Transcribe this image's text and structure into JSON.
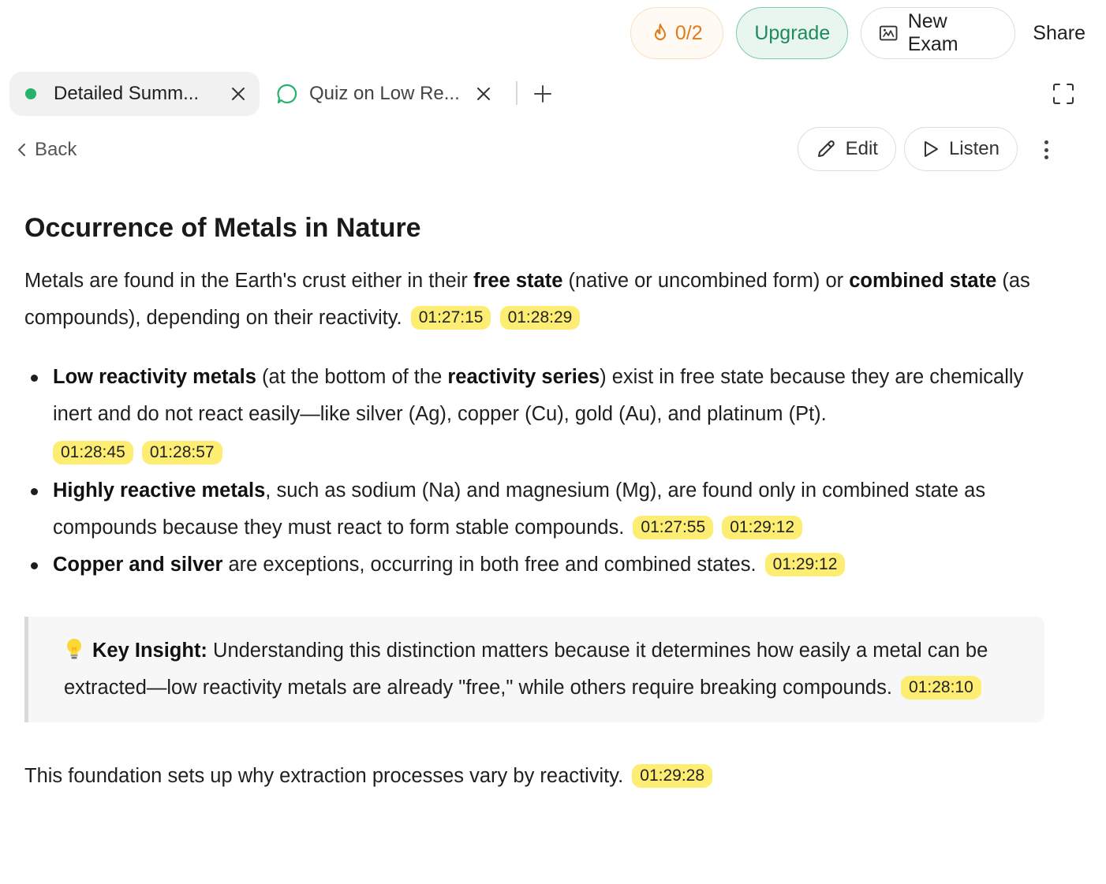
{
  "topbar": {
    "streak": "0/2",
    "upgrade": "Upgrade",
    "new_exam": "New Exam",
    "share": "Share"
  },
  "tabs": [
    {
      "label": "Detailed Summ..."
    },
    {
      "label": "Quiz on Low Re..."
    }
  ],
  "toolbar": {
    "back": "Back",
    "edit": "Edit",
    "listen": "Listen"
  },
  "article": {
    "title": "Occurrence of Metals in Nature",
    "intro": {
      "t1": "Metals are found in the Earth's crust either in their ",
      "b1": "free state",
      "t2": " (native or uncombined form) or ",
      "b2": "combined state",
      "t3": " (as compounds), depending on their reactivity.",
      "ts": [
        "01:27:15",
        "01:28:29"
      ]
    },
    "bullets": [
      {
        "b1": "Low reactivity metals",
        "t1": " (at the bottom of the ",
        "b2": "reactivity series",
        "t2": ") exist in free state because they are chemically inert and do not react easily—like silver (Ag), copper (Cu), gold (Au), and platinum (Pt).",
        "ts": [
          "01:28:45",
          "01:28:57"
        ]
      },
      {
        "b1": "Highly reactive metals",
        "t1": ", such as sodium (Na) and magnesium (Mg), are found only in combined state as compounds because they must react to form stable compounds.",
        "ts": [
          "01:27:55",
          "01:29:12"
        ]
      },
      {
        "b1": "Copper and silver",
        "t1": " are exceptions, occurring in both free and combined states.",
        "ts": [
          "01:29:12"
        ]
      }
    ],
    "insight": {
      "label": "Key Insight:",
      "text": " Understanding this distinction matters because it determines how easily a metal can be extracted—low reactivity metals are already \"free,\" while others require breaking compounds.",
      "ts": "01:28:10"
    },
    "closing": {
      "text": "This foundation sets up why extraction processes vary by reactivity.",
      "ts": "01:29:28"
    }
  },
  "colors": {
    "accent_green": "#25b26b",
    "highlight": "#fdee73",
    "streak_orange": "#e07b1a"
  }
}
